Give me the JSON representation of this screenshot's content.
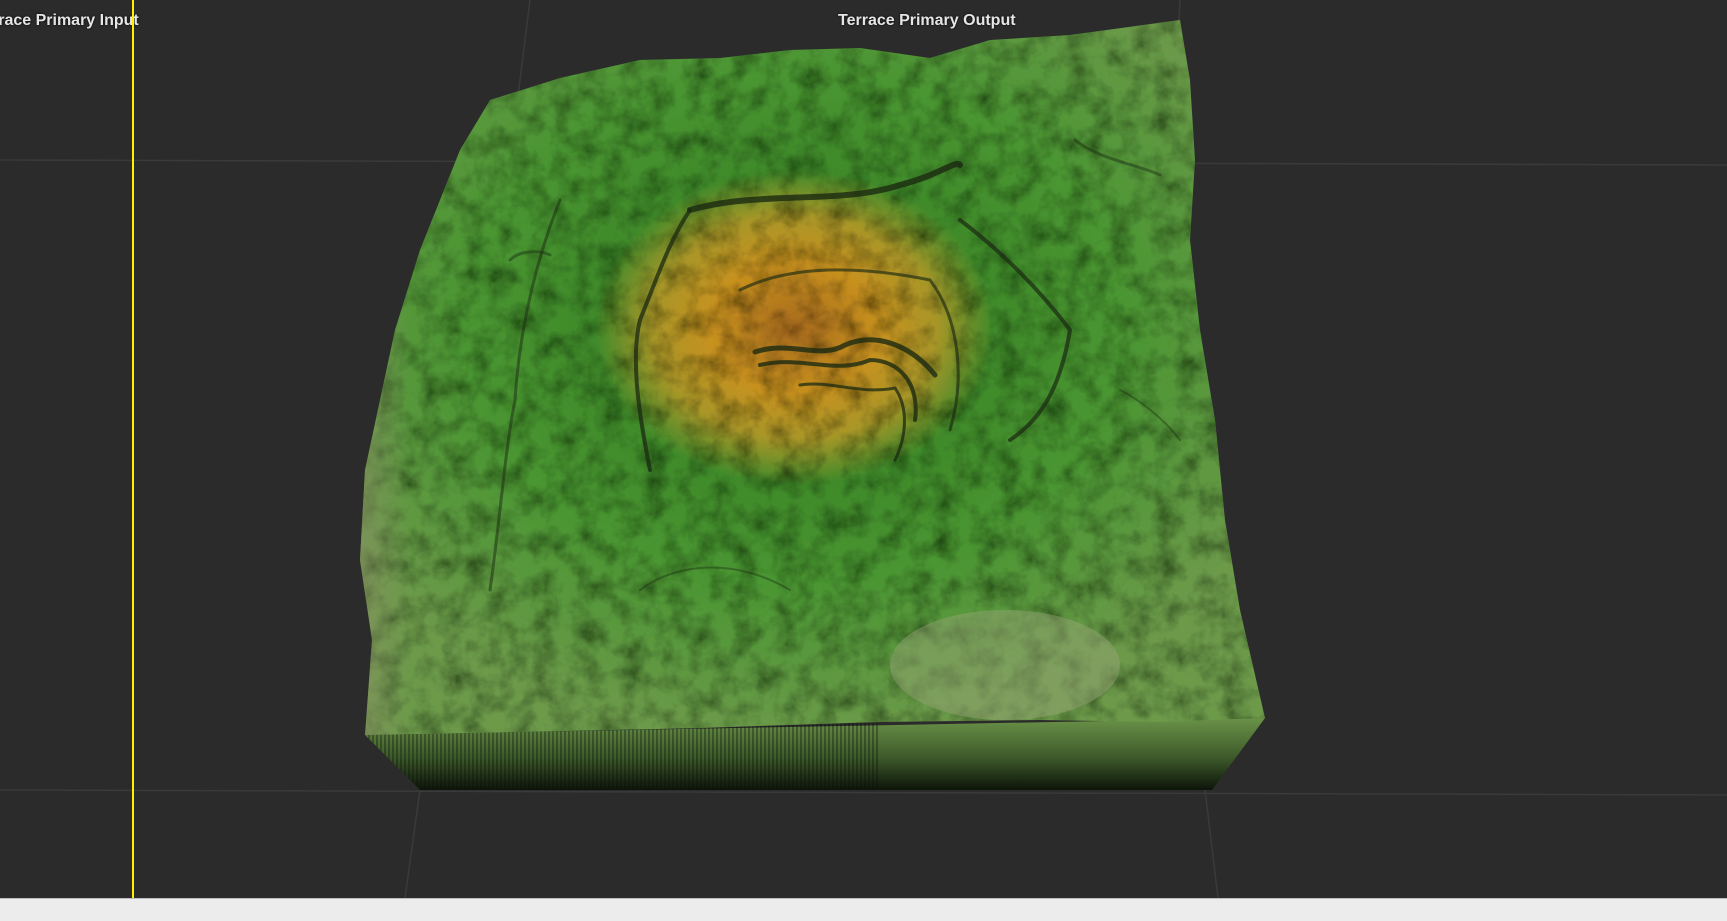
{
  "viewport": {
    "input_label": "rrace Primary Input",
    "output_label": "Terrace Primary Output"
  },
  "colors": {
    "background": "#2b2b2b",
    "split_line": "#fff200",
    "terrain_low": "#4e9a34",
    "terrain_high": "#c8901f"
  }
}
